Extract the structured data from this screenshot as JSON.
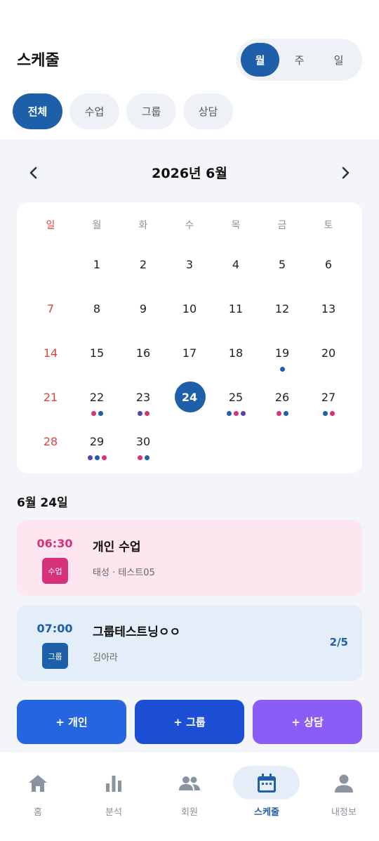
{
  "header": {
    "title": "스케줄"
  },
  "view_toggle": {
    "options": [
      "월",
      "주",
      "일"
    ],
    "active": "월"
  },
  "filters": {
    "items": [
      "전체",
      "수업",
      "그룹",
      "상담"
    ],
    "active": "전체"
  },
  "calendar": {
    "title": "2026년 6월",
    "weekdays": [
      "일",
      "월",
      "화",
      "수",
      "목",
      "금",
      "토"
    ],
    "selected_day": "24",
    "days": [
      "1",
      "2",
      "3",
      "4",
      "5",
      "6",
      "7",
      "8",
      "9",
      "10",
      "11",
      "12",
      "13",
      "14",
      "15",
      "16",
      "17",
      "18",
      "19",
      "20",
      "21",
      "22",
      "23",
      "24",
      "25",
      "26",
      "27",
      "28",
      "29",
      "30"
    ],
    "dots": {
      "19": [
        "#1d5fa8"
      ],
      "22": [
        "#d6317a",
        "#1d5fa8"
      ],
      "23": [
        "#5b3fb0",
        "#d6317a"
      ],
      "25": [
        "#1d5fa8",
        "#d6317a",
        "#5b3fb0"
      ],
      "26": [
        "#d6317a",
        "#1d5fa8"
      ],
      "27": [
        "#1d5fa8",
        "#d6317a"
      ],
      "29": [
        "#5b3fb0",
        "#1d5fa8",
        "#d6317a"
      ],
      "30": [
        "#d6317a",
        "#1d5fa8"
      ]
    }
  },
  "selected_date_label": "6월 24일",
  "events": [
    {
      "time": "06:30",
      "tag": "수업",
      "title": "개인 수업",
      "sub": "태성 · 테스트05",
      "count": "",
      "bg": "#fde6f0",
      "accent": "#d6317a"
    },
    {
      "time": "07:00",
      "tag": "그룹",
      "title": "그룹테스트닝ㅇㅇ",
      "sub": "김아라",
      "count": "2/5",
      "bg": "#e3eef9",
      "accent": "#1d5fa8"
    }
  ],
  "actions": [
    {
      "label": "+ 개인",
      "color": "#2565e0"
    },
    {
      "label": "+ 그룹",
      "color": "#1d4fd6"
    },
    {
      "label": "+ 상담",
      "color": "#8b5cf6"
    }
  ],
  "tabbar": {
    "items": [
      {
        "label": "홈",
        "icon": "home-icon"
      },
      {
        "label": "분석",
        "icon": "bar-chart-icon"
      },
      {
        "label": "회원",
        "icon": "people-icon"
      },
      {
        "label": "스케줄",
        "icon": "calendar-icon"
      },
      {
        "label": "내정보",
        "icon": "person-icon"
      }
    ],
    "active": "스케줄"
  },
  "colors": {
    "primary": "#1d5fa8",
    "sunday": "#d9443e",
    "muted": "#8a93a0"
  }
}
